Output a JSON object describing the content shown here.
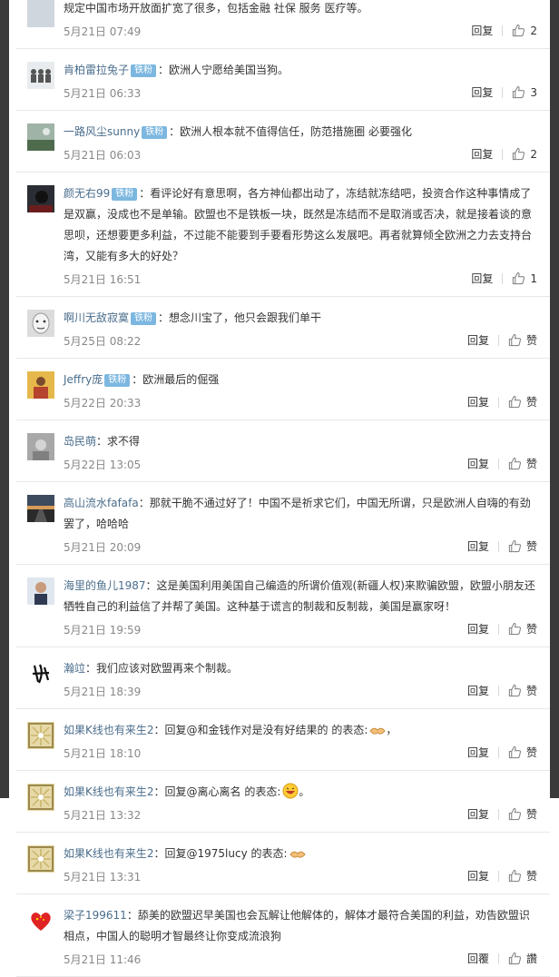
{
  "comments": [
    {
      "user": "",
      "badge": "",
      "text": "规定中国市场开放面扩宽了很多，包括金融 社保 服务 医疗等。",
      "time": "5月21日 07:49",
      "reply": "回复",
      "likes": "2",
      "avatar": "blank"
    },
    {
      "user": "肯柏雷拉兔子",
      "badge": "铁粉",
      "text": "：欧洲人宁愿给美国当狗。",
      "time": "5月21日 06:33",
      "reply": "回复",
      "likes": "3",
      "avatar": "figures"
    },
    {
      "user": "一路风尘sunny",
      "badge": "铁粉",
      "text": "：欧洲人根本就不值得信任，防范措施圈 必要强化",
      "time": "5月21日 06:03",
      "reply": "回复",
      "likes": "2",
      "avatar": "landscape"
    },
    {
      "user": "颜无右99",
      "badge": "铁粉",
      "text": "：看评论好有意思啊，各方神仙都出动了，冻结就冻结吧，投资合作这种事情成了是双赢，没成也不是单输。欧盟也不是铁板一块，既然是冻结而不是取消或否决，就是接着谈的意思呗，还想要更多利益，不过能不能要到手要看形势这么发展吧。再者就算倾全欧洲之力去支持台湾，又能有多大的好处？",
      "time": "5月21日 16:51",
      "reply": "回复",
      "likes": "1",
      "avatar": "dark"
    },
    {
      "user": "啊川无敌寂寞",
      "badge": "铁粉",
      "text": "：想念川宝了，他只会跟我们单干",
      "time": "5月25日 08:22",
      "reply": "回复",
      "likes": "赞",
      "avatar": "face"
    },
    {
      "user": "Jeffry庞",
      "badge": "铁粉",
      "text": "：欧洲最后的倔强",
      "time": "5月22日 20:33",
      "reply": "回复",
      "likes": "赞",
      "avatar": "person"
    },
    {
      "user": "岛民萌",
      "badge": "",
      "text": "：求不得",
      "time": "5月22日 13:05",
      "reply": "回复",
      "likes": "赞",
      "avatar": "grey"
    },
    {
      "user": "高山流水fafafa",
      "badge": "",
      "text": "：那就干脆不通过好了！中国不是祈求它们，中国无所谓，只是欧洲人自嗨的有劲罢了，哈哈哈",
      "time": "5月21日 20:09",
      "reply": "回复",
      "likes": "赞",
      "avatar": "road"
    },
    {
      "user": "海里的鱼儿1987",
      "badge": "",
      "text": "：这是美国利用美国自己编造的所谓价值观(新疆人权)来欺骗欧盟，欧盟小朋友还牺牲自己的利益信了并帮了美国。这种基于谎言的制裁和反制裁，美国是赢家呀！",
      "time": "5月21日 19:59",
      "reply": "回复",
      "likes": "赞",
      "avatar": "man"
    },
    {
      "user": "瀚竝",
      "badge": "",
      "text": "：我们应该对欧盟再来个制裁。",
      "time": "5月21日 18:39",
      "reply": "回复",
      "likes": "赞",
      "avatar": "calligraphy"
    },
    {
      "user": "如果K线也有来生2",
      "badge": "",
      "text": "：回复@和金钱作对是没有好结果的 的表态:",
      "text_after": "，",
      "emoji": "handshake",
      "time": "5月21日 18:10",
      "reply": "回复",
      "likes": "赞",
      "avatar": "pattern"
    },
    {
      "user": "如果K线也有来生2",
      "badge": "",
      "text": "：回复@离心离名 的表态:",
      "text_after": "。",
      "emoji": "laugh",
      "time": "5月21日 13:32",
      "reply": "回复",
      "likes": "赞",
      "avatar": "pattern"
    },
    {
      "user": "如果K线也有来生2",
      "badge": "",
      "text": "：回复@1975lucy 的表态:",
      "text_after": "",
      "emoji": "handshake",
      "time": "5月21日 13:31",
      "reply": "回复",
      "likes": "赞",
      "avatar": "pattern"
    },
    {
      "user": "梁子199611",
      "badge": "",
      "text": "：舔美的欧盟迟早美国也会瓦解让他解体的，解体才最符合美国的利益，劝告欧盟识相点，中国人的聪明才智最终让你变成流浪狗",
      "time": "5月21日 11:46",
      "reply": "回覆",
      "likes": "讚",
      "avatar": "heart"
    }
  ],
  "colors": {
    "username": "#4a6d8c",
    "badge": "#7cb7e0",
    "time": "#888888",
    "divider": "#e8e8e8"
  }
}
